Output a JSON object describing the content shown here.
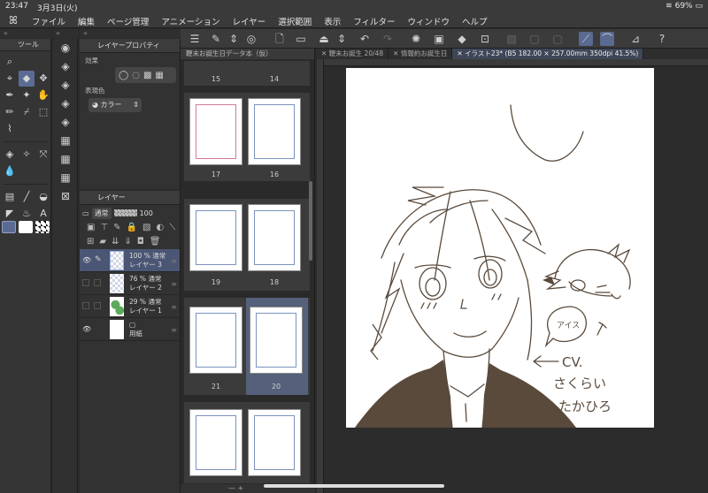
{
  "status": {
    "time": "23:47",
    "date": "3月3日(火)",
    "battery": "69%"
  },
  "menu": [
    "ファイル",
    "編集",
    "ページ管理",
    "アニメーション",
    "レイヤー",
    "選択範囲",
    "表示",
    "フィルター",
    "ウィンドウ",
    "ヘルプ"
  ],
  "tool_panel": {
    "title": "ツール"
  },
  "property_panel": {
    "title": "レイヤープロパティ",
    "effects_label": "効果",
    "color_label": "表現色",
    "color_value": "カラー"
  },
  "layer_panel": {
    "title": "レイヤー",
    "blend_mode": "通常",
    "opacity": "100",
    "layers": [
      {
        "pct": "100 %",
        "mode": "通常",
        "name": "レイヤー 3",
        "selected": true
      },
      {
        "pct": "76 %",
        "mode": "通常",
        "name": "レイヤー 2",
        "selected": false
      },
      {
        "pct": "29 %",
        "mode": "通常",
        "name": "レイヤー 1",
        "selected": false
      },
      {
        "pct": "",
        "mode": "",
        "name": "用紙",
        "selected": false
      }
    ]
  },
  "page_panel": {
    "tab": "鞭末お誕生日データ本（仮）",
    "pages": [
      "15",
      "14",
      "17",
      "16",
      "19",
      "18",
      "21",
      "20"
    ],
    "footer": "—   +"
  },
  "tabs": [
    {
      "label": "鞭末お誕生 20/48"
    },
    {
      "label": "情報約お誕生日"
    },
    {
      "label": "イラスト23* (B5 182.00 × 257.00mm 350dpi 41.5%)"
    }
  ],
  "artwork": {
    "cv_text": "CV.",
    "name_line1": "さくらい",
    "name_line2": "たかひろ",
    "bubble_text": "アイス"
  },
  "colors": {
    "accent": "#5b6c94",
    "ink": "#5a4a3c"
  }
}
